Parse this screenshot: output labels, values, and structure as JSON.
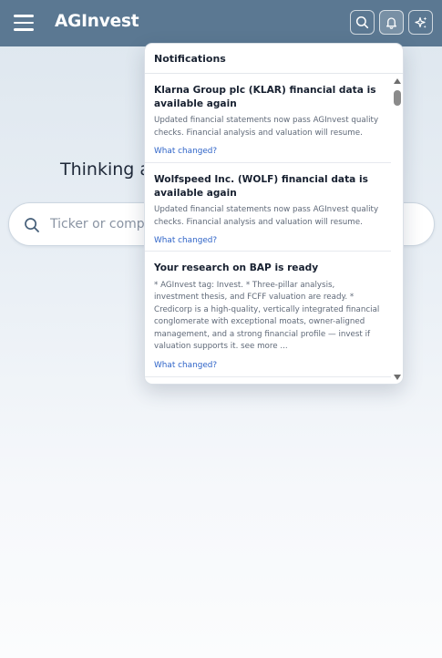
{
  "app": {
    "title": "AGInvest"
  },
  "header": {
    "menu_icon": "hamburger-menu-icon",
    "search_icon": "search-icon",
    "notifications_icon": "bell-icon",
    "ai_icon": "sparkles-icon"
  },
  "main": {
    "heading": "Thinking a",
    "search_placeholder": "Ticker or compa"
  },
  "notifications": {
    "title": "Notifications",
    "items": [
      {
        "title": "Klarna Group plc (KLAR) financial data is available again",
        "body": "Updated financial statements now pass AGInvest quality checks. Financial analysis and valuation will resume.",
        "link": "What changed?"
      },
      {
        "title": "Wolfspeed Inc. (WOLF) financial data is available again",
        "body": "Updated financial statements now pass AGInvest quality checks. Financial analysis and valuation will resume.",
        "link": "What changed?"
      },
      {
        "title": "Your research on BAP is ready",
        "body": "* AGInvest tag: Invest. * Three-pillar analysis, investment thesis, and FCFF valuation are ready. * Credicorp is a high-quality, vertically integrated financial conglomerate with exceptional moats, owner-aligned management, and a strong financial profile — invest if valuation supports it. see more ...",
        "link": "What changed?"
      }
    ]
  },
  "colors": {
    "topbar": "#5b7892",
    "link": "#2f64c8",
    "accent_text": "#1b2433"
  }
}
